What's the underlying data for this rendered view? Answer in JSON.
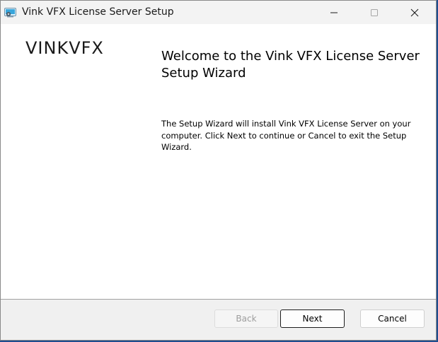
{
  "window": {
    "title": "Vink VFX License Server Setup",
    "app_icon": "installer-icon",
    "controls": {
      "minimize_icon": "minimize-icon",
      "maximize_icon": "maximize-icon",
      "close_icon": "close-icon"
    }
  },
  "brand": {
    "logo_text": "VINKVFX"
  },
  "wizard": {
    "heading": "Welcome to the Vink VFX License Server Setup Wizard",
    "description": "The Setup Wizard will install Vink VFX License Server on your computer. Click Next to continue or Cancel to exit the Setup Wizard."
  },
  "footer": {
    "back_label": "Back",
    "back_enabled": false,
    "next_label": "Next",
    "cancel_label": "Cancel"
  },
  "colors": {
    "titlebar": "#f3f3f3",
    "content_bg": "#ffffff",
    "footer_bg": "#f0f0f0",
    "disabled_text": "#9d9d9d",
    "desktop_accent": "#1f4d8f"
  }
}
